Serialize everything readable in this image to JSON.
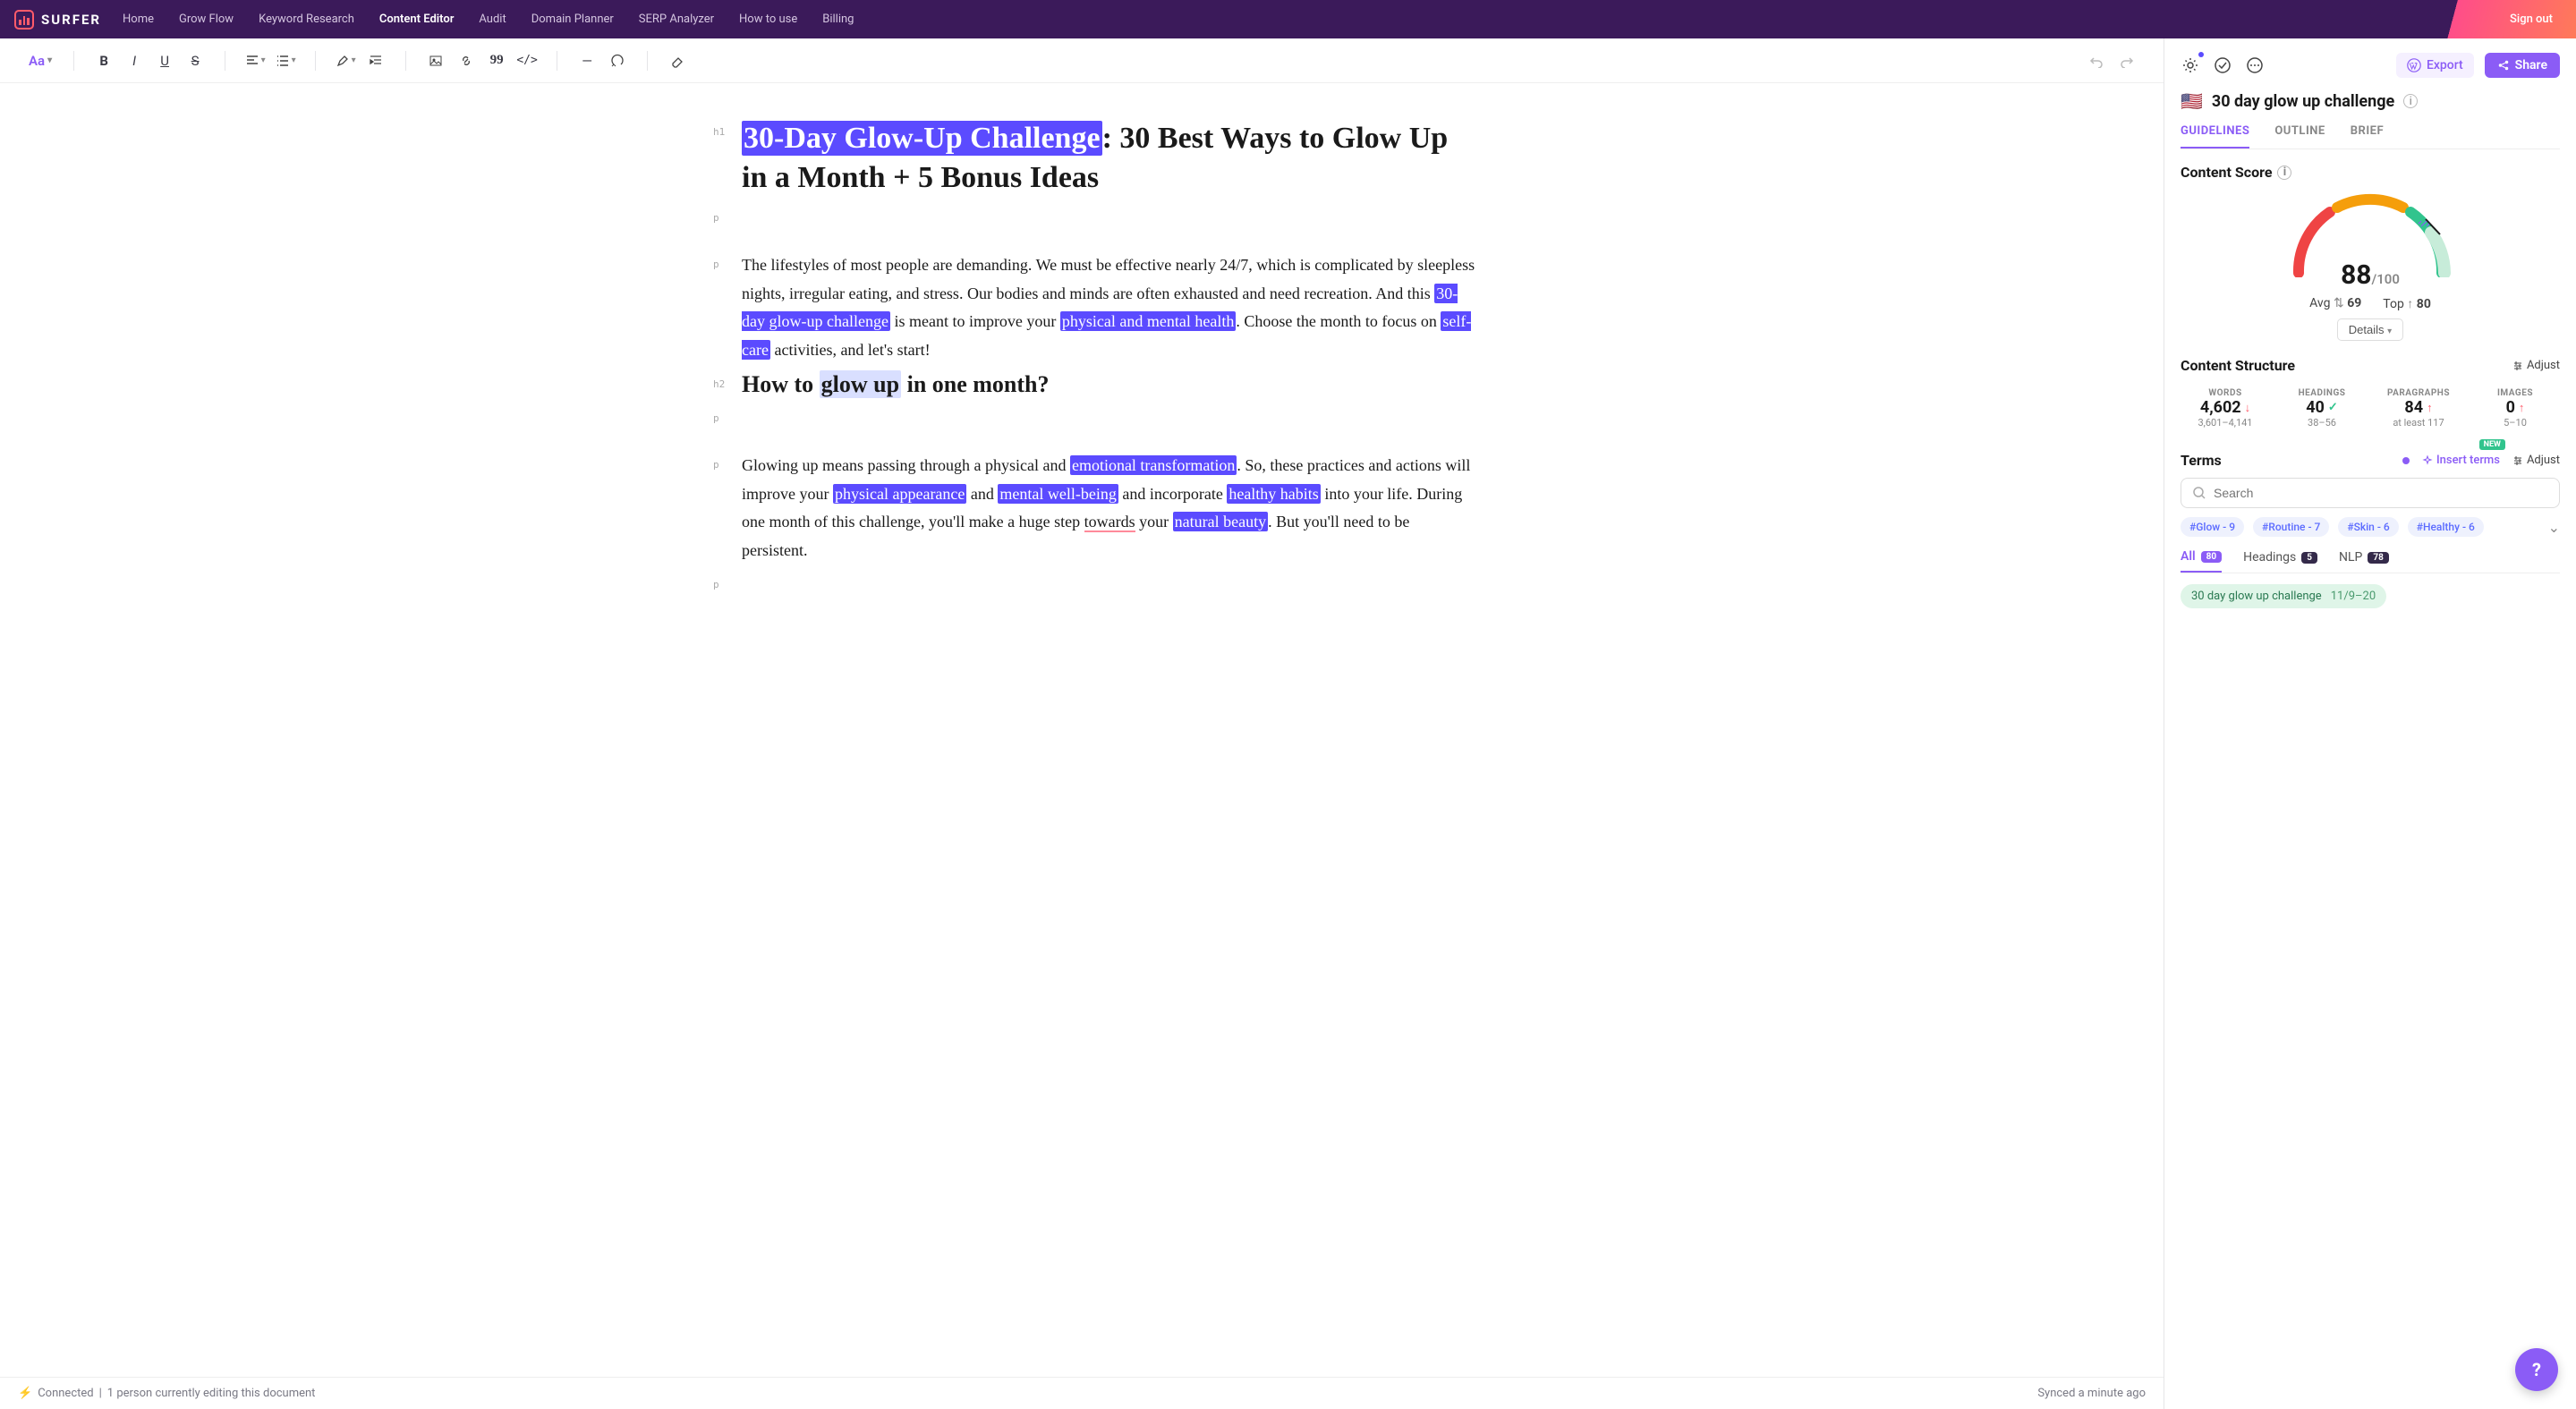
{
  "brand": "SURFER",
  "nav": {
    "items": [
      "Home",
      "Grow Flow",
      "Keyword Research",
      "Content Editor",
      "Audit",
      "Domain Planner",
      "SERP Analyzer",
      "How to use",
      "Billing"
    ],
    "active_index": 3,
    "signout": "Sign out"
  },
  "toolbar": {
    "aa": "Aa"
  },
  "doc": {
    "h1_hl": "30-Day Glow-Up Challenge",
    "h1_rest": ": 30 Best Ways to Glow Up in a Month + 5 Bonus Ideas",
    "p1_a": "The lifestyles of most people are demanding. We must be effective nearly 24/7, which is complicated by sleepless nights, irregular eating, and stress. Our bodies and minds are often exhausted and need recreation. And this ",
    "p1_hl1": "30-day glow-up challenge",
    "p1_b": " is meant to improve your ",
    "p1_hl2": "physical and mental health",
    "p1_c": ". Choose the month to focus on ",
    "p1_hl3": "self-care",
    "p1_d": " activities, and let's start!",
    "h2_a": "How to ",
    "h2_hl": "glow up",
    "h2_b": " in one month?",
    "p2_a": "Glowing up means passing through a physical and ",
    "p2_hl1": "emotional transformation",
    "p2_b": ". So, these practices and actions will improve your ",
    "p2_hl2": "physical appearance",
    "p2_c": " and ",
    "p2_hl3": "mental well-being",
    "p2_d": " and incorporate ",
    "p2_hl4": "healthy habits",
    "p2_e": " into your life. During one month of this challenge, you'll make a huge step ",
    "p2_sq": "towards",
    "p2_f": " your ",
    "p2_hl5": "natural beauty",
    "p2_g": ". But you'll need to be persistent."
  },
  "status": {
    "connected": "Connected",
    "editing": "1 person currently editing this document",
    "synced": "Synced a minute ago"
  },
  "side": {
    "export": "Export",
    "share": "Share",
    "flag": "🇺🇸",
    "query": "30 day glow up challenge",
    "tabs": [
      "GUIDELINES",
      "OUTLINE",
      "BRIEF"
    ],
    "active_tab": 0,
    "content_score_label": "Content Score",
    "score": "88",
    "score_max": "/100",
    "avg_label": "Avg",
    "avg_val": "69",
    "top_label": "Top",
    "top_val": "80",
    "details": "Details",
    "cs_label": "Content Structure",
    "adjust": "Adjust",
    "structure": [
      {
        "label": "WORDS",
        "value": "4,602",
        "dir": "down",
        "range": "3,601–4,141"
      },
      {
        "label": "HEADINGS",
        "value": "40",
        "dir": "ok",
        "range": "38–56"
      },
      {
        "label": "PARAGRAPHS",
        "value": "84",
        "dir": "up",
        "range": "at least 117"
      },
      {
        "label": "IMAGES",
        "value": "0",
        "dir": "up",
        "range": "5–10"
      }
    ],
    "terms_label": "Terms",
    "insert_terms": "Insert terms",
    "new_badge": "NEW",
    "search_placeholder": "Search",
    "hashes": [
      "#Glow - 9",
      "#Routine - 7",
      "#Skin - 6",
      "#Healthy - 6"
    ],
    "term_tabs": [
      {
        "label": "All",
        "count": "80"
      },
      {
        "label": "Headings",
        "count": "5"
      },
      {
        "label": "NLP",
        "count": "78"
      }
    ],
    "active_term_tab": 0,
    "term_pills": [
      {
        "text": "30 day glow up challenge",
        "range": "11/9–20"
      }
    ]
  }
}
